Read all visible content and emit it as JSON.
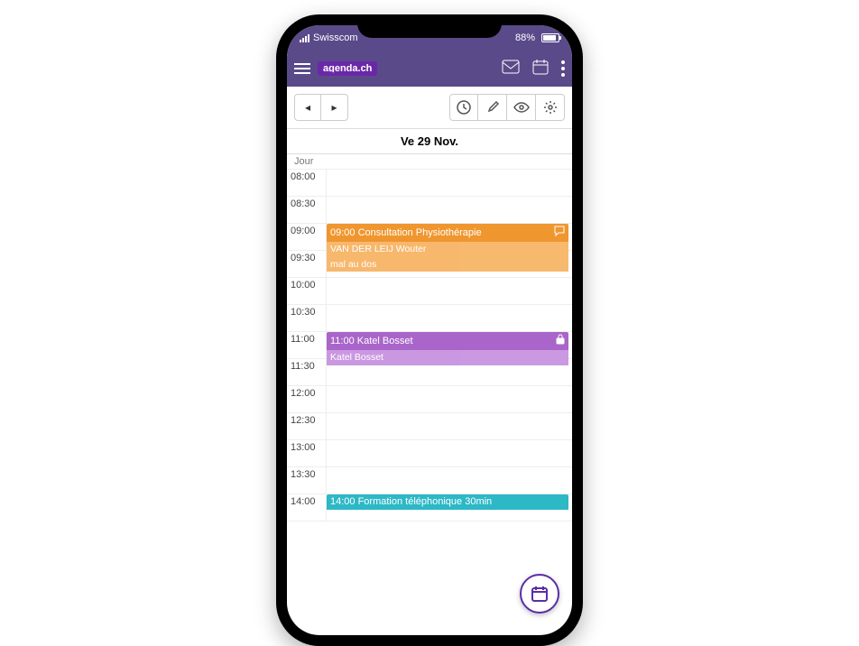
{
  "status": {
    "carrier": "Swisscom",
    "battery_pct": "88%"
  },
  "header": {
    "logo_text": "agenda.ch"
  },
  "date_header": "Ve 29 Nov.",
  "day_label": "Jour",
  "time_slots": [
    "08:00",
    "08:30",
    "09:00",
    "09:30",
    "10:00",
    "10:30",
    "11:00",
    "11:30",
    "12:00",
    "12:30",
    "13:00",
    "13:30",
    "14:00"
  ],
  "events": [
    {
      "id": "physio",
      "color": "orange",
      "row_start": 2,
      "row_span": 2,
      "time": "09:00",
      "title": "Consultation Physiothérapie",
      "line1": "VAN DER LEIJ Wouter",
      "line2": "mal au dos",
      "corner_icon": "speech"
    },
    {
      "id": "katel",
      "color": "purple",
      "row_start": 6,
      "row_span": 2,
      "time": "11:00",
      "title": "Katel Bosset",
      "line1": "Katel Bosset",
      "line2": "",
      "corner_icon": "lock"
    },
    {
      "id": "formation",
      "color": "cyan",
      "row_start": 12,
      "row_span": 1,
      "time": "14:00",
      "title": "Formation téléphonique 30min",
      "line1": "",
      "line2": "",
      "corner_icon": ""
    }
  ]
}
